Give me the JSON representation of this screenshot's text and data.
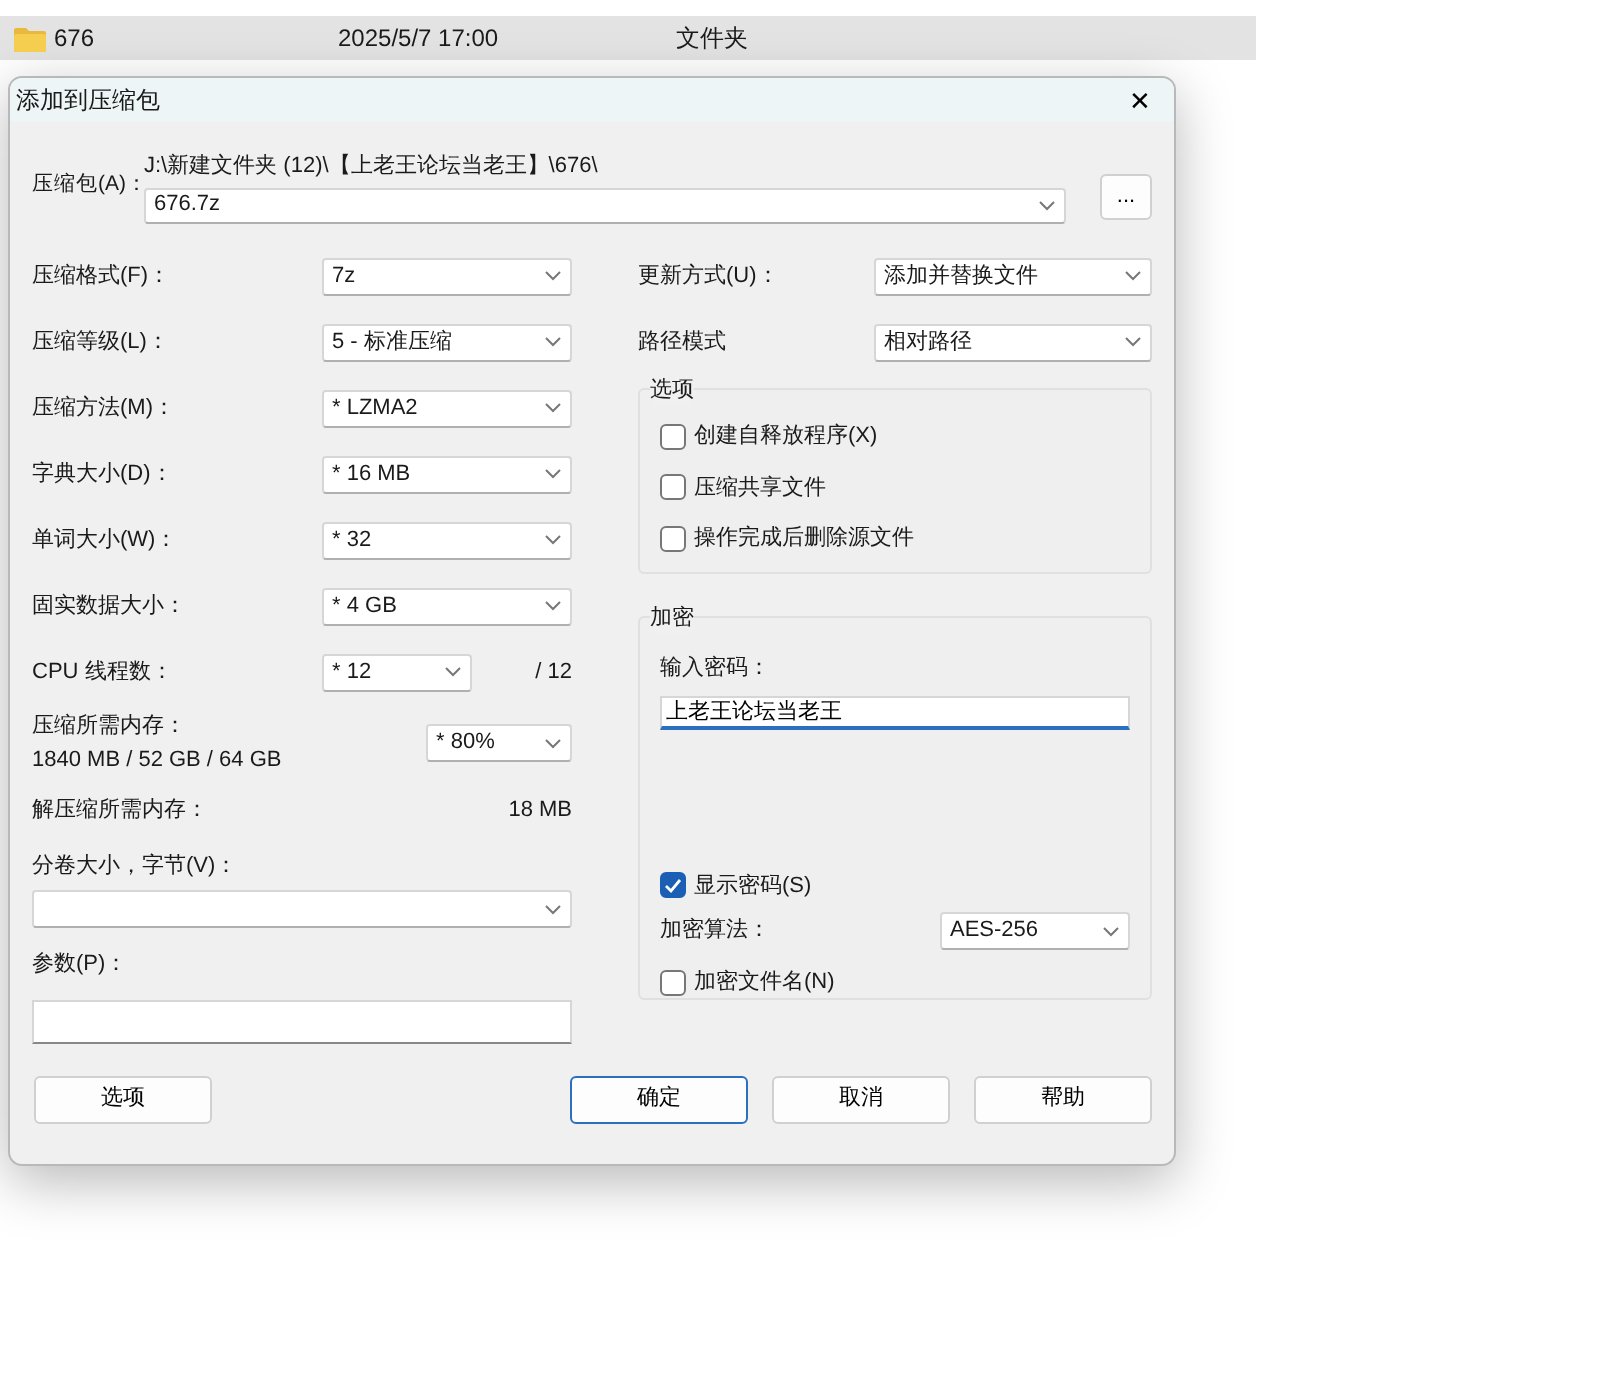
{
  "file_row": {
    "name": "676",
    "date": "2025/5/7 17:00",
    "type": "文件夹"
  },
  "dialog": {
    "title": "添加到压缩包",
    "close": "✕",
    "archive": {
      "label": "压缩包(A)：",
      "path": "J:\\新建文件夹 (12)\\【上老王论坛当老王】\\676\\",
      "value": "676.7z",
      "browse": "..."
    },
    "left_rows": [
      {
        "kind": "select",
        "label": "压缩格式(F)：",
        "value": "7z"
      },
      {
        "kind": "select",
        "label": "压缩等级(L)：",
        "value": "5 - 标准压缩"
      },
      {
        "kind": "select",
        "label": "压缩方法(M)：",
        "value": "*  LZMA2"
      },
      {
        "kind": "select",
        "label": "字典大小(D)：",
        "value": "*  16 MB"
      },
      {
        "kind": "select",
        "label": "单词大小(W)：",
        "value": "*  32"
      },
      {
        "kind": "select",
        "label": "固实数据大小：",
        "value": "*  4 GB"
      },
      {
        "kind": "short",
        "label": "CPU 线程数：",
        "value": "*  12",
        "suffix": "/ 12"
      },
      {
        "kind": "memory",
        "label": "压缩所需内存：",
        "detail": "1840 MB / 52 GB / 64 GB",
        "value": "*  80%"
      },
      {
        "kind": "info",
        "label": "解压缩所需内存：",
        "value": "18 MB"
      },
      {
        "kind": "wide-select",
        "label": "分卷大小，字节(V)："
      },
      {
        "kind": "wide-input",
        "label": "参数(P)："
      }
    ],
    "options_button": "选项",
    "right_rows": [
      {
        "label": "更新方式(U)：",
        "value": "添加并替换文件"
      },
      {
        "label": "路径模式",
        "value": "相对路径"
      }
    ],
    "options_group": {
      "title": "选项",
      "items": [
        {
          "label": "创建自释放程序(X)",
          "checked": false
        },
        {
          "label": "压缩共享文件",
          "checked": false
        },
        {
          "label": "操作完成后删除源文件",
          "checked": false
        }
      ]
    },
    "encryption": {
      "title": "加密",
      "password_label": "输入密码：",
      "password": "上老王论坛当老王",
      "show_password": {
        "label": "显示密码(S)",
        "checked": true
      },
      "method_label": "加密算法：",
      "method": "AES-256",
      "encrypt_names": {
        "label": "加密文件名(N)",
        "checked": false
      }
    },
    "buttons": [
      {
        "label": "确定",
        "default": true
      },
      {
        "label": "取消",
        "default": false
      },
      {
        "label": "帮助",
        "default": false
      }
    ]
  }
}
